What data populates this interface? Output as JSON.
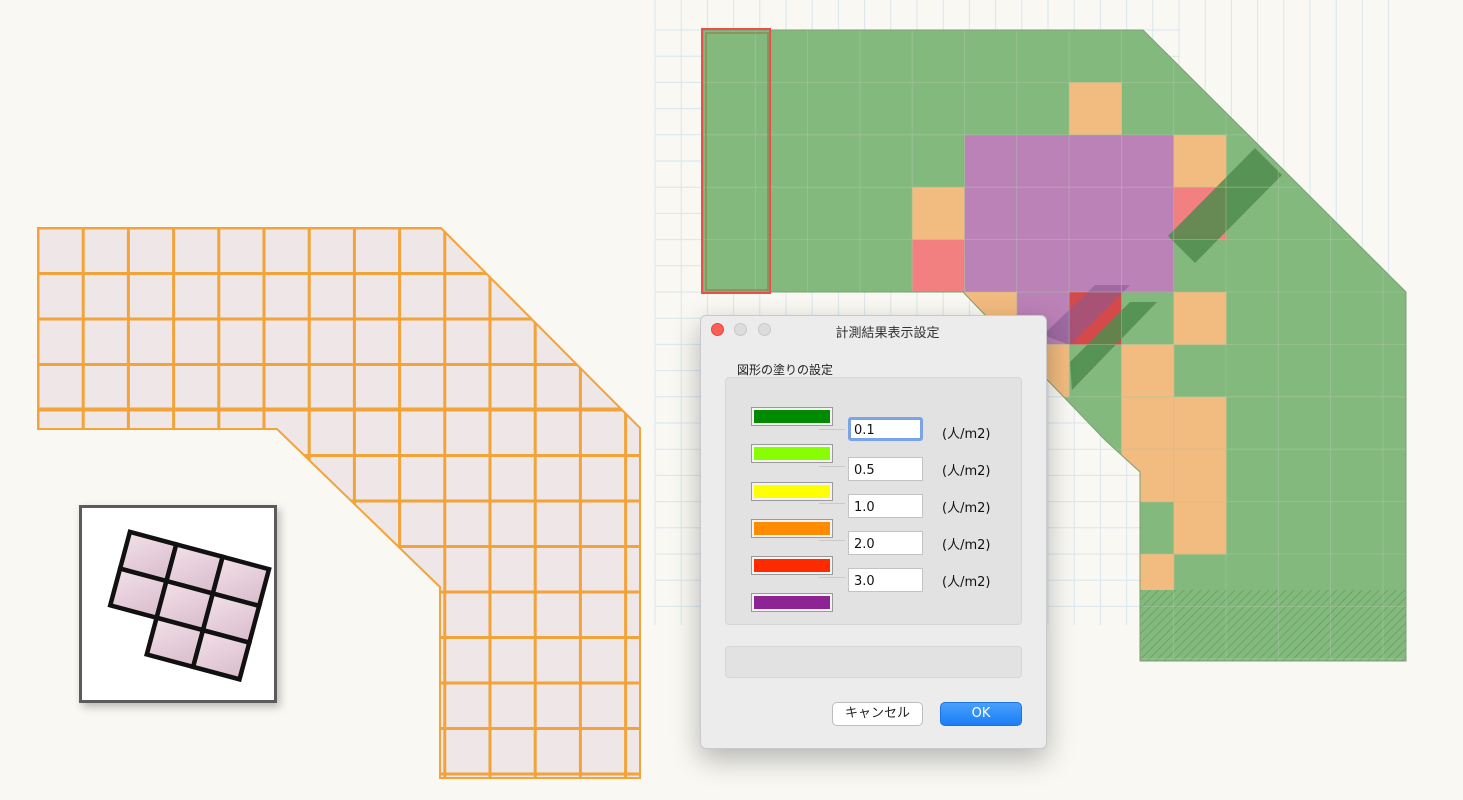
{
  "dialog": {
    "title": "計測結果表示設定",
    "group_label": "図形の塗りの設定",
    "legend": [
      {
        "color": "#008a00",
        "value": "0.1",
        "unit": "(人/m2)"
      },
      {
        "color": "#88ff00",
        "value": "0.5",
        "unit": "(人/m2)"
      },
      {
        "color": "#ffff00",
        "value": "1.0",
        "unit": "(人/m2)"
      },
      {
        "color": "#ff8c00",
        "value": "2.0",
        "unit": "(人/m2)"
      },
      {
        "color": "#ff2a00",
        "value": "3.0",
        "unit": "(人/m2)"
      },
      {
        "color": "#8e2394"
      }
    ],
    "cancel_label": "キャンセル",
    "ok_label": "OK"
  },
  "colors": {
    "mesh_fill": "#efe6e8",
    "mesh_line": "#f2a33a",
    "heat_green": "#84b97e",
    "heat_orange": "#f2bb7f",
    "heat_purple": "#bb82b7",
    "heat_red": "#f28080",
    "heat_darkred": "#d44a4a",
    "heat_darkgreen": "#4f8c4c",
    "selection": "#e8514b",
    "dialog_accent": "#1a7ef6"
  },
  "icons": {
    "mesh_tool": "tilted-grid-icon"
  }
}
